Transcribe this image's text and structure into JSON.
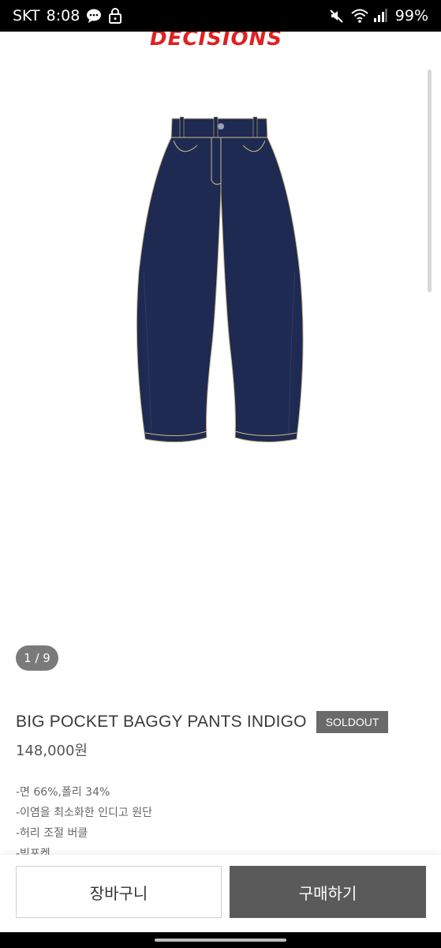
{
  "status_bar": {
    "carrier": "SKT",
    "time": "8:08",
    "battery": "99%",
    "left_icons": [
      "chat-bubble-icon",
      "lock-icon"
    ],
    "right_icons": [
      "mute-icon",
      "wifi-icon",
      "signal-icon"
    ]
  },
  "brand": {
    "logo_text": "DECISIONS",
    "logo_color": "#e02020"
  },
  "gallery": {
    "counter": "1 / 9",
    "image": "indigo-baggy-jeans"
  },
  "product": {
    "title": "BIG POCKET BAGGY PANTS INDIGO",
    "badge": "SOLDOUT",
    "price": "148,000원",
    "description": [
      "-면 66%,폴리 34%",
      "-이염을 최소화한 인디고 원단",
      "-허리 조절 버클",
      "-빅포켓"
    ]
  },
  "actions": {
    "cart_label": "장바구니",
    "buy_label": "구매하기"
  },
  "colors": {
    "buy_button": "#5a5a5a",
    "soldout_badge": "#6a6a6a",
    "denim": "#1f2a52",
    "stitching": "#c9b98a"
  }
}
